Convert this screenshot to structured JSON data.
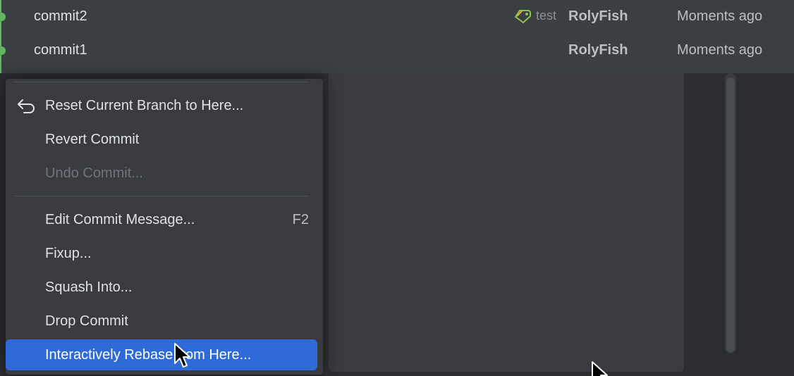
{
  "commit_log": {
    "rows": [
      {
        "message": "commit2",
        "tag": "test",
        "author": "RolyFish",
        "date": "Moments ago"
      },
      {
        "message": "commit1",
        "tag": "",
        "author": "RolyFish",
        "date": "Moments ago"
      }
    ]
  },
  "context_menu": {
    "items": [
      {
        "label": "Reset Current Branch to Here...",
        "icon": "undo-arrow-icon",
        "enabled": true
      },
      {
        "label": "Revert Commit",
        "enabled": true
      },
      {
        "label": "Undo Commit...",
        "enabled": false
      },
      {
        "label": "Edit Commit Message...",
        "shortcut": "F2",
        "enabled": true
      },
      {
        "label": "Fixup...",
        "enabled": true
      },
      {
        "label": "Squash Into...",
        "enabled": true
      },
      {
        "label": "Drop Commit",
        "enabled": true
      },
      {
        "label": "Interactively Rebase from Here...",
        "enabled": true,
        "selected": true
      }
    ]
  },
  "colors": {
    "graph_node": "#5fb85b",
    "selection": "#2e6bd6",
    "tag_icon": "#8bc34a"
  }
}
